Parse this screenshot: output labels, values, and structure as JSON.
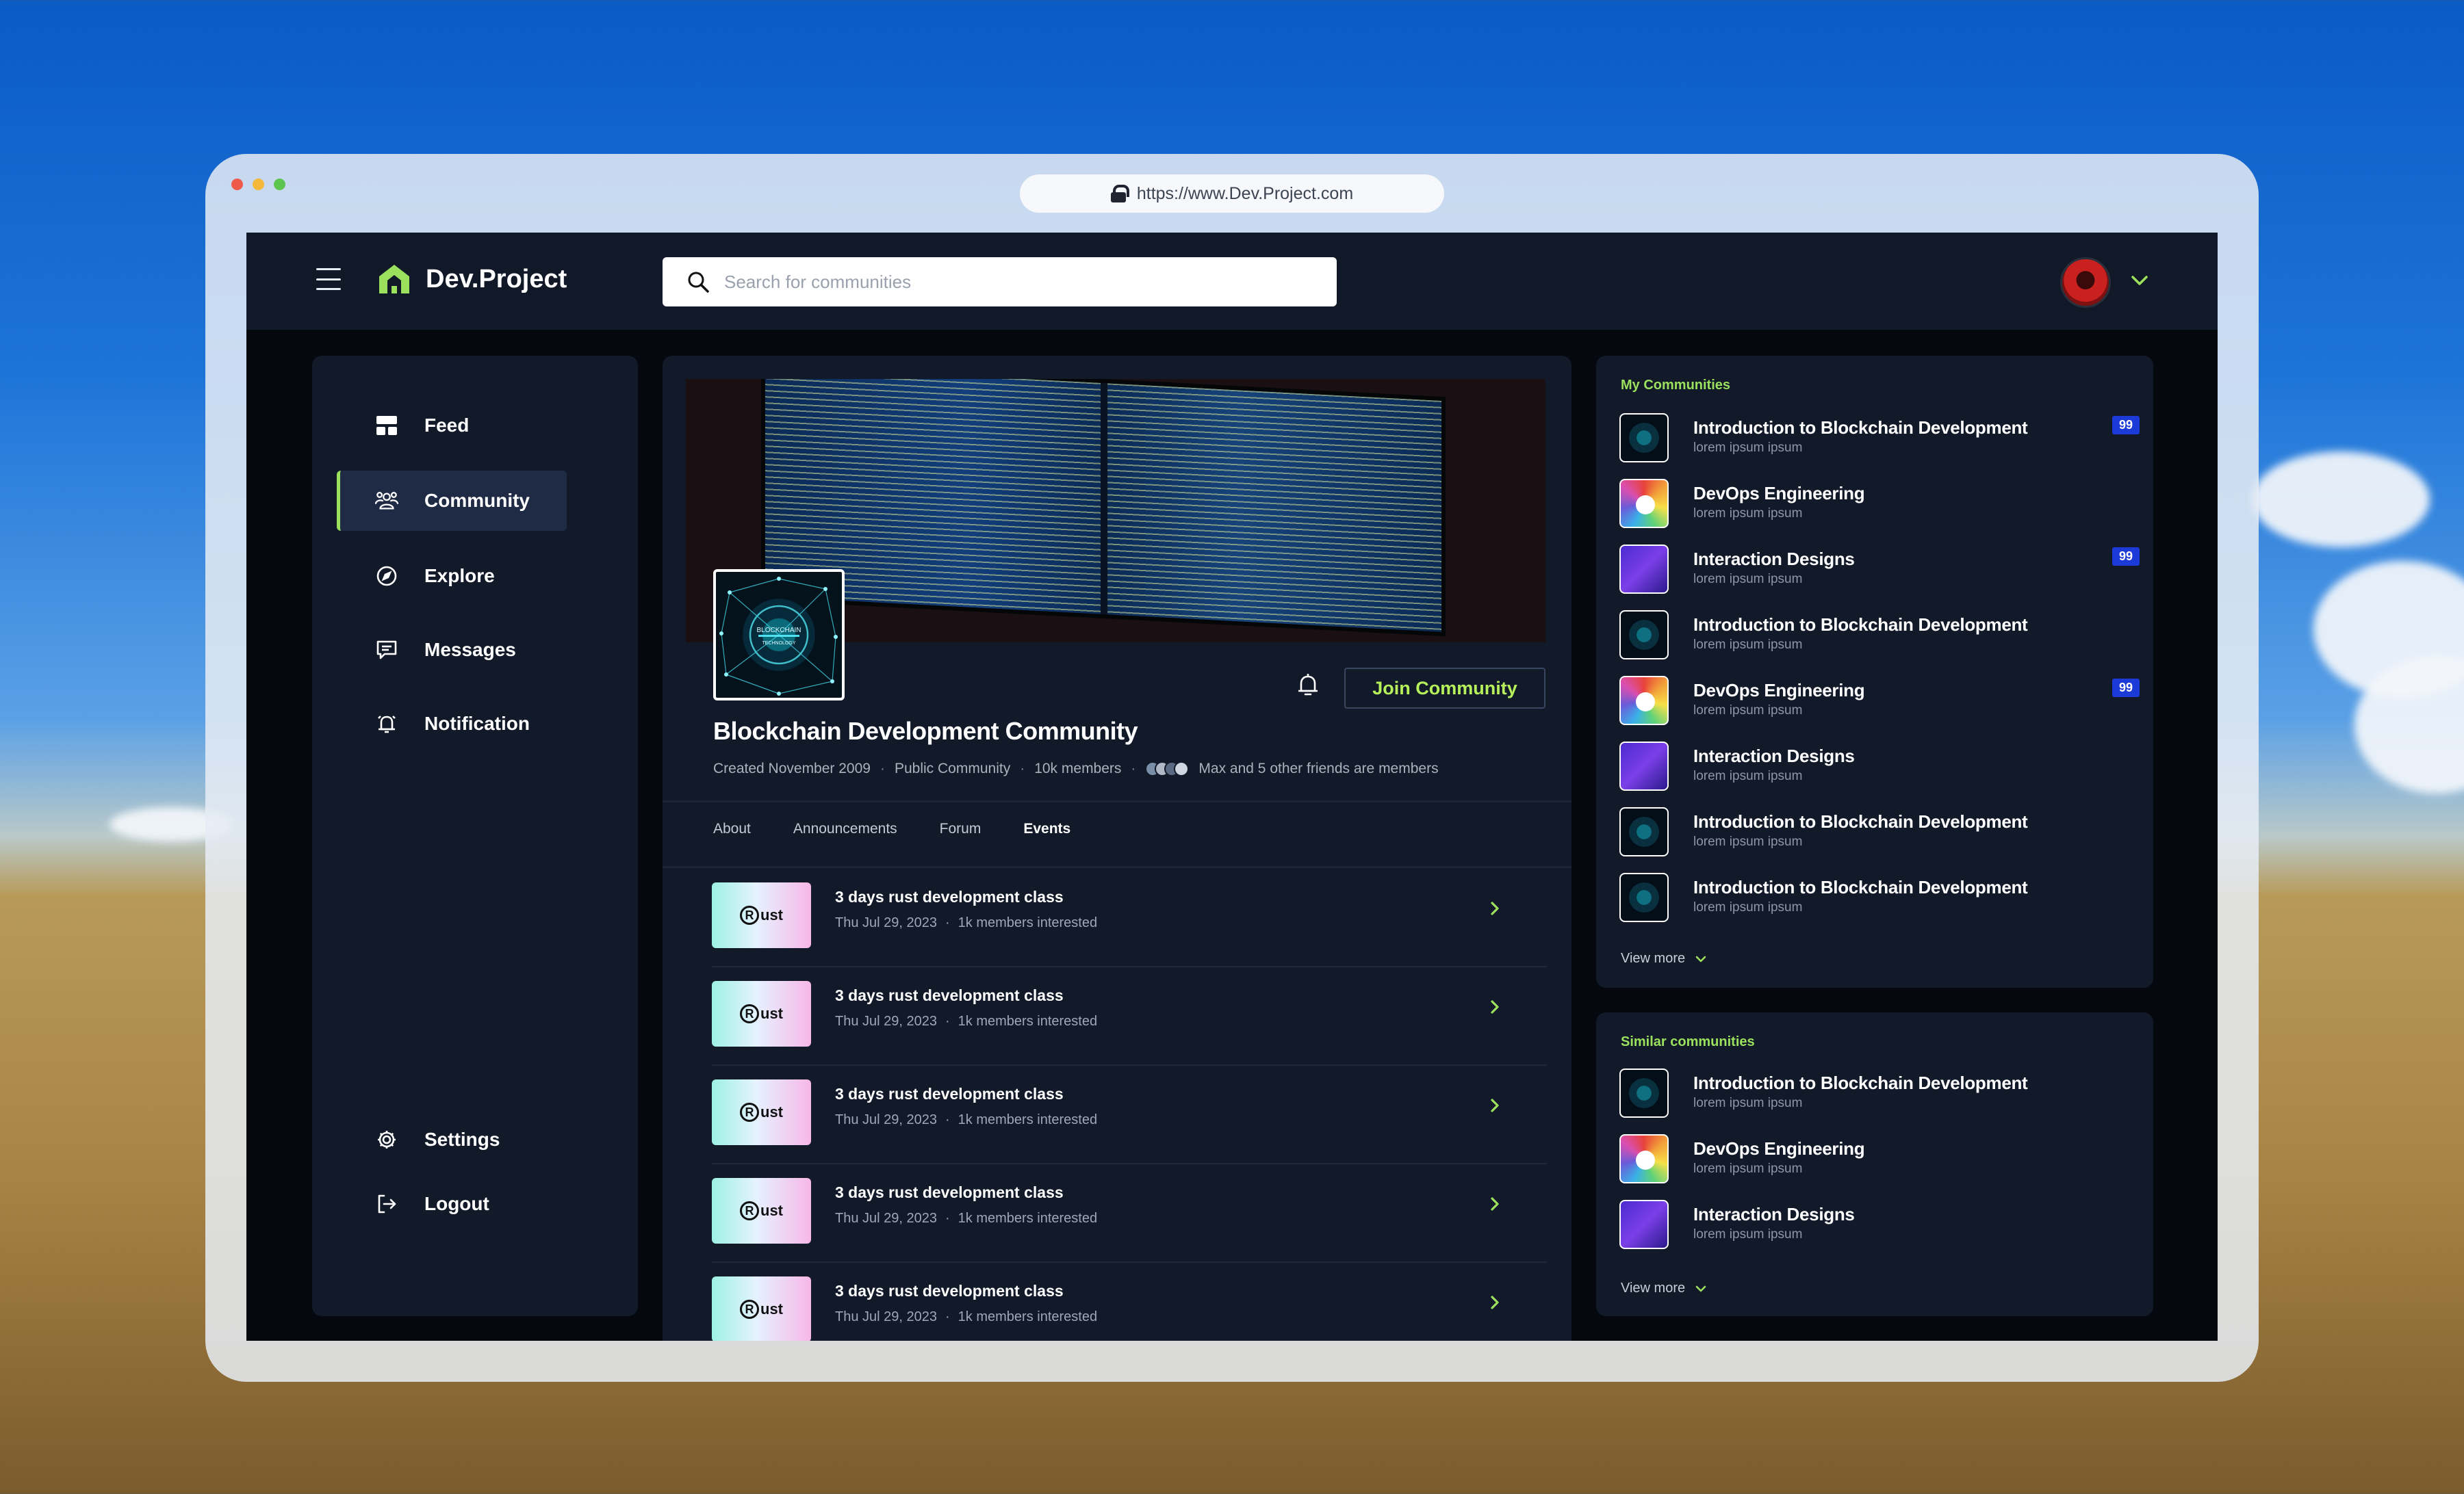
{
  "browser": {
    "url": "https://www.Dev.Project.com",
    "dots": [
      "#ee5b4c",
      "#f4b93a",
      "#5ec450"
    ]
  },
  "header": {
    "app_name": "Dev.Project",
    "search_placeholder": "Search for communities"
  },
  "colors": {
    "accent": "#9be15d",
    "join_text": "#b6f05a",
    "badge": "#1c3ad8",
    "panel_bg": "#121a2a"
  },
  "sidebar": {
    "items": [
      {
        "label": "Feed",
        "icon": "feed-icon",
        "active": false
      },
      {
        "label": "Community",
        "icon": "community-icon",
        "active": true
      },
      {
        "label": "Explore",
        "icon": "compass-icon",
        "active": false
      },
      {
        "label": "Messages",
        "icon": "message-icon",
        "active": false
      },
      {
        "label": "Notification",
        "icon": "bell-icon",
        "active": false
      }
    ],
    "bottom_items": [
      {
        "label": "Settings",
        "icon": "gear-icon"
      },
      {
        "label": "Logout",
        "icon": "logout-icon"
      }
    ]
  },
  "community": {
    "title": "Blockchain Development Community",
    "created": "Created November 2009",
    "visibility": "Public Community",
    "members": "10k members",
    "friends_text": "Max and 5 other friends are members",
    "join_label": "Join Community",
    "thumb_text_line1": "BLOCKCHAIN",
    "thumb_text_line2": "TECHNOLOGY"
  },
  "tabs": [
    {
      "label": "About",
      "active": false
    },
    {
      "label": "Announcements",
      "active": false
    },
    {
      "label": "Forum",
      "active": false
    },
    {
      "label": "Events",
      "active": true
    }
  ],
  "events": [
    {
      "title": "3 days rust development class",
      "date": "Thu Jul 29, 2023",
      "interest": "1k members interested",
      "thumb": "ust"
    },
    {
      "title": "3 days rust development class",
      "date": "Thu Jul 29, 2023",
      "interest": "1k members interested",
      "thumb": "ust"
    },
    {
      "title": "3 days rust development class",
      "date": "Thu Jul 29, 2023",
      "interest": "1k members interested",
      "thumb": "ust"
    },
    {
      "title": "3 days rust development class",
      "date": "Thu Jul 29, 2023",
      "interest": "1k members interested",
      "thumb": "ust"
    },
    {
      "title": "3 days rust development class",
      "date": "Thu Jul 29, 2023",
      "interest": "1k members interested",
      "thumb": "ust"
    }
  ],
  "my_communities": {
    "title": "My Communities",
    "items": [
      {
        "name": "Introduction to Blockchain Development",
        "sub": "lorem ipsum ipsum",
        "badge": "99",
        "thumb": "blockchain"
      },
      {
        "name": "DevOps Engineering",
        "sub": "lorem ipsum ipsum",
        "badge": "",
        "thumb": "devops"
      },
      {
        "name": "Interaction Designs",
        "sub": "lorem ipsum ipsum",
        "badge": "99",
        "thumb": "ixd"
      },
      {
        "name": "Introduction to Blockchain Development",
        "sub": "lorem ipsum ipsum",
        "badge": "",
        "thumb": "blockchain"
      },
      {
        "name": "DevOps Engineering",
        "sub": "lorem ipsum ipsum",
        "badge": "99",
        "thumb": "devops"
      },
      {
        "name": "Interaction Designs",
        "sub": "lorem ipsum ipsum",
        "badge": "",
        "thumb": "ixd"
      },
      {
        "name": "Introduction to Blockchain Development",
        "sub": "lorem ipsum ipsum",
        "badge": "",
        "thumb": "blockchain"
      },
      {
        "name": "Introduction to Blockchain Development",
        "sub": "lorem ipsum ipsum",
        "badge": "",
        "thumb": "blockchain"
      }
    ],
    "view_more": "View more"
  },
  "similar_communities": {
    "title": "Similar communities",
    "items": [
      {
        "name": "Introduction to Blockchain Development",
        "sub": "lorem ipsum ipsum",
        "thumb": "blockchain"
      },
      {
        "name": "DevOps Engineering",
        "sub": "lorem ipsum ipsum",
        "thumb": "devops"
      },
      {
        "name": "Interaction Designs",
        "sub": "lorem ipsum ipsum",
        "thumb": "ixd"
      }
    ],
    "view_more": "View more"
  }
}
